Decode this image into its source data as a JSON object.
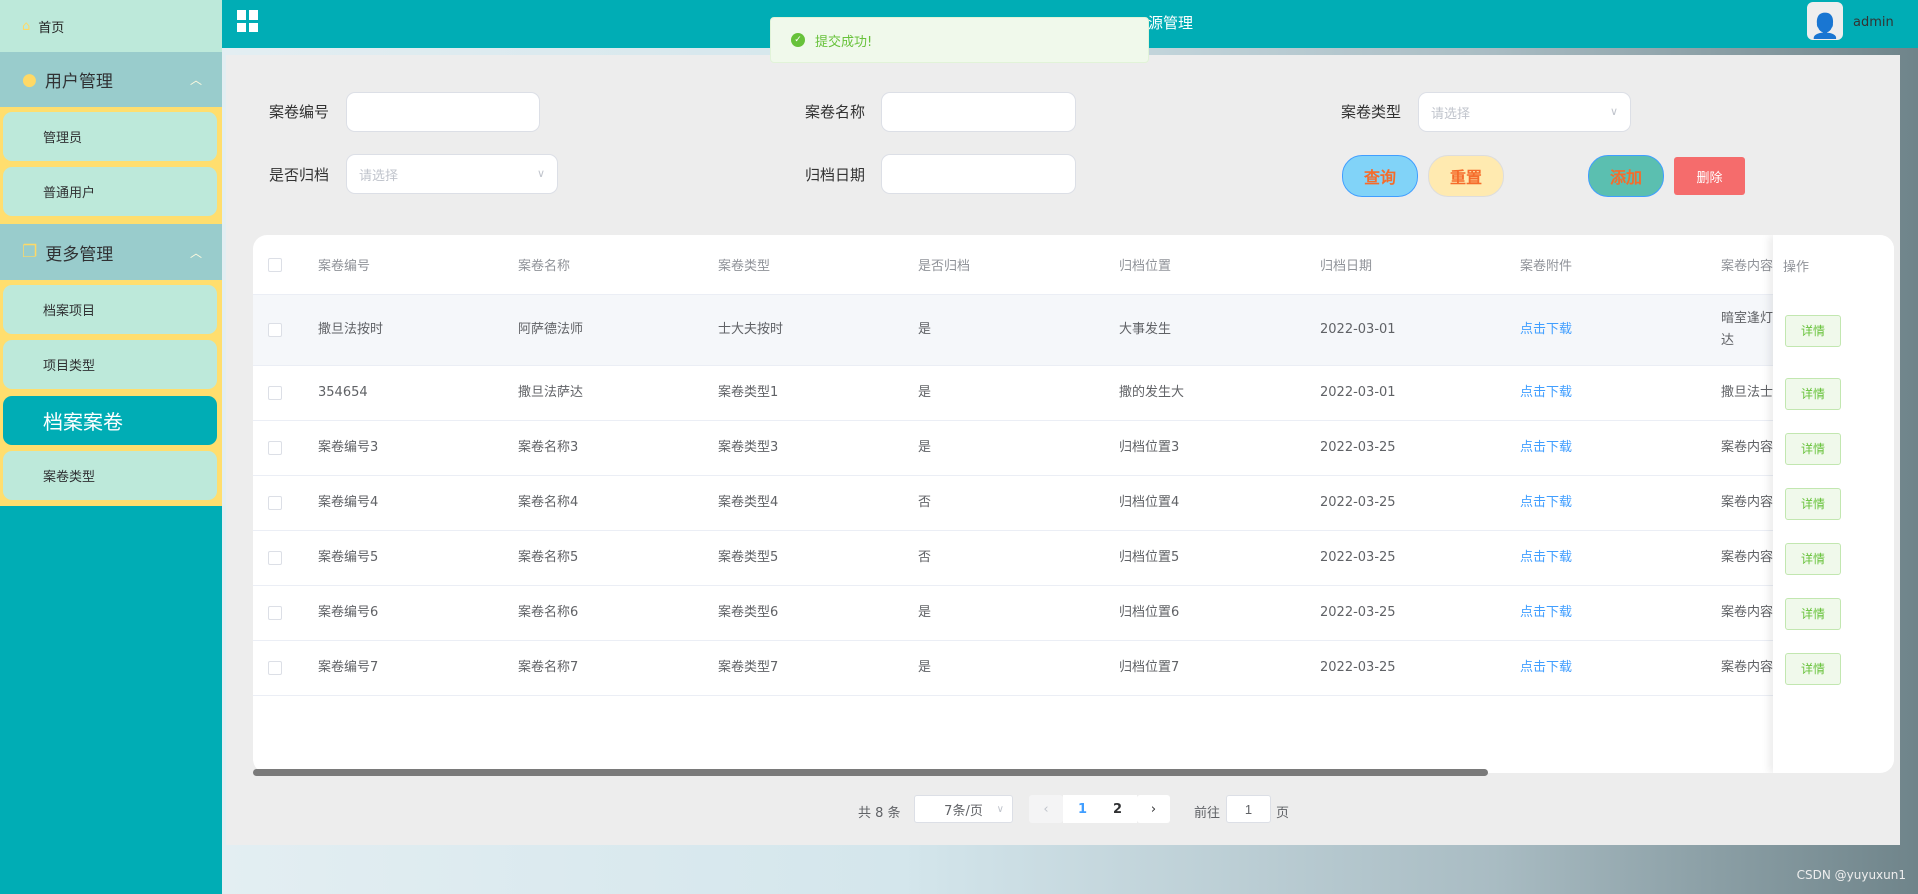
{
  "header": {
    "title_visible": "源管理",
    "user": "admin"
  },
  "toast": {
    "message": "提交成功!",
    "type": "success"
  },
  "sidebar": {
    "home": "首页",
    "groups": [
      {
        "label": "用户管理",
        "items": [
          "管理员",
          "普通用户"
        ]
      },
      {
        "label": "更多管理",
        "items": [
          "档案项目",
          "项目类型",
          "档案案卷",
          "案卷类型"
        ]
      }
    ],
    "active": "档案案卷"
  },
  "search": {
    "fields": [
      {
        "label": "案卷编号",
        "value": ""
      },
      {
        "label": "案卷名称",
        "value": ""
      },
      {
        "label": "案卷类型",
        "placeholder": "请选择"
      },
      {
        "label": "是否归档",
        "placeholder": "请选择"
      },
      {
        "label": "归档日期",
        "value": ""
      }
    ],
    "buttons": {
      "query": "查询",
      "reset": "重置",
      "add": "添加",
      "delete": "删除"
    }
  },
  "table": {
    "columns": [
      "案卷编号",
      "案卷名称",
      "案卷类型",
      "是否归档",
      "归档位置",
      "归档日期",
      "案卷附件",
      "案卷内容",
      "操作"
    ],
    "rows": [
      [
        "撒旦法按时",
        "阿萨德法师",
        "士大夫按时",
        "是",
        "大事发生",
        "2022-03-01",
        "点击下载",
        "暗室逢灯\n达",
        "详情"
      ],
      [
        "354654",
        "撒旦法萨达",
        "案卷类型1",
        "是",
        "撒的发生大",
        "2022-03-01",
        "点击下载",
        "撒旦法士",
        "详情"
      ],
      [
        "案卷编号3",
        "案卷名称3",
        "案卷类型3",
        "是",
        "归档位置3",
        "2022-03-25",
        "点击下载",
        "案卷内容",
        "详情"
      ],
      [
        "案卷编号4",
        "案卷名称4",
        "案卷类型4",
        "否",
        "归档位置4",
        "2022-03-25",
        "点击下载",
        "案卷内容",
        "详情"
      ],
      [
        "案卷编号5",
        "案卷名称5",
        "案卷类型5",
        "否",
        "归档位置5",
        "2022-03-25",
        "点击下载",
        "案卷内容",
        "详情"
      ],
      [
        "案卷编号6",
        "案卷名称6",
        "案卷类型6",
        "是",
        "归档位置6",
        "2022-03-25",
        "点击下载",
        "案卷内容",
        "详情"
      ],
      [
        "案卷编号7",
        "案卷名称7",
        "案卷类型7",
        "是",
        "归档位置7",
        "2022-03-25",
        "点击下载",
        "案卷内容",
        "详情"
      ]
    ]
  },
  "pagination": {
    "total": "共 8 条",
    "page_size": "7条/页",
    "pages": [
      "1",
      "2"
    ],
    "current": "1",
    "goto_label": "前往",
    "goto_value": "1",
    "page_suffix": "页"
  },
  "watermark": "CSDN @yuyuxun1"
}
